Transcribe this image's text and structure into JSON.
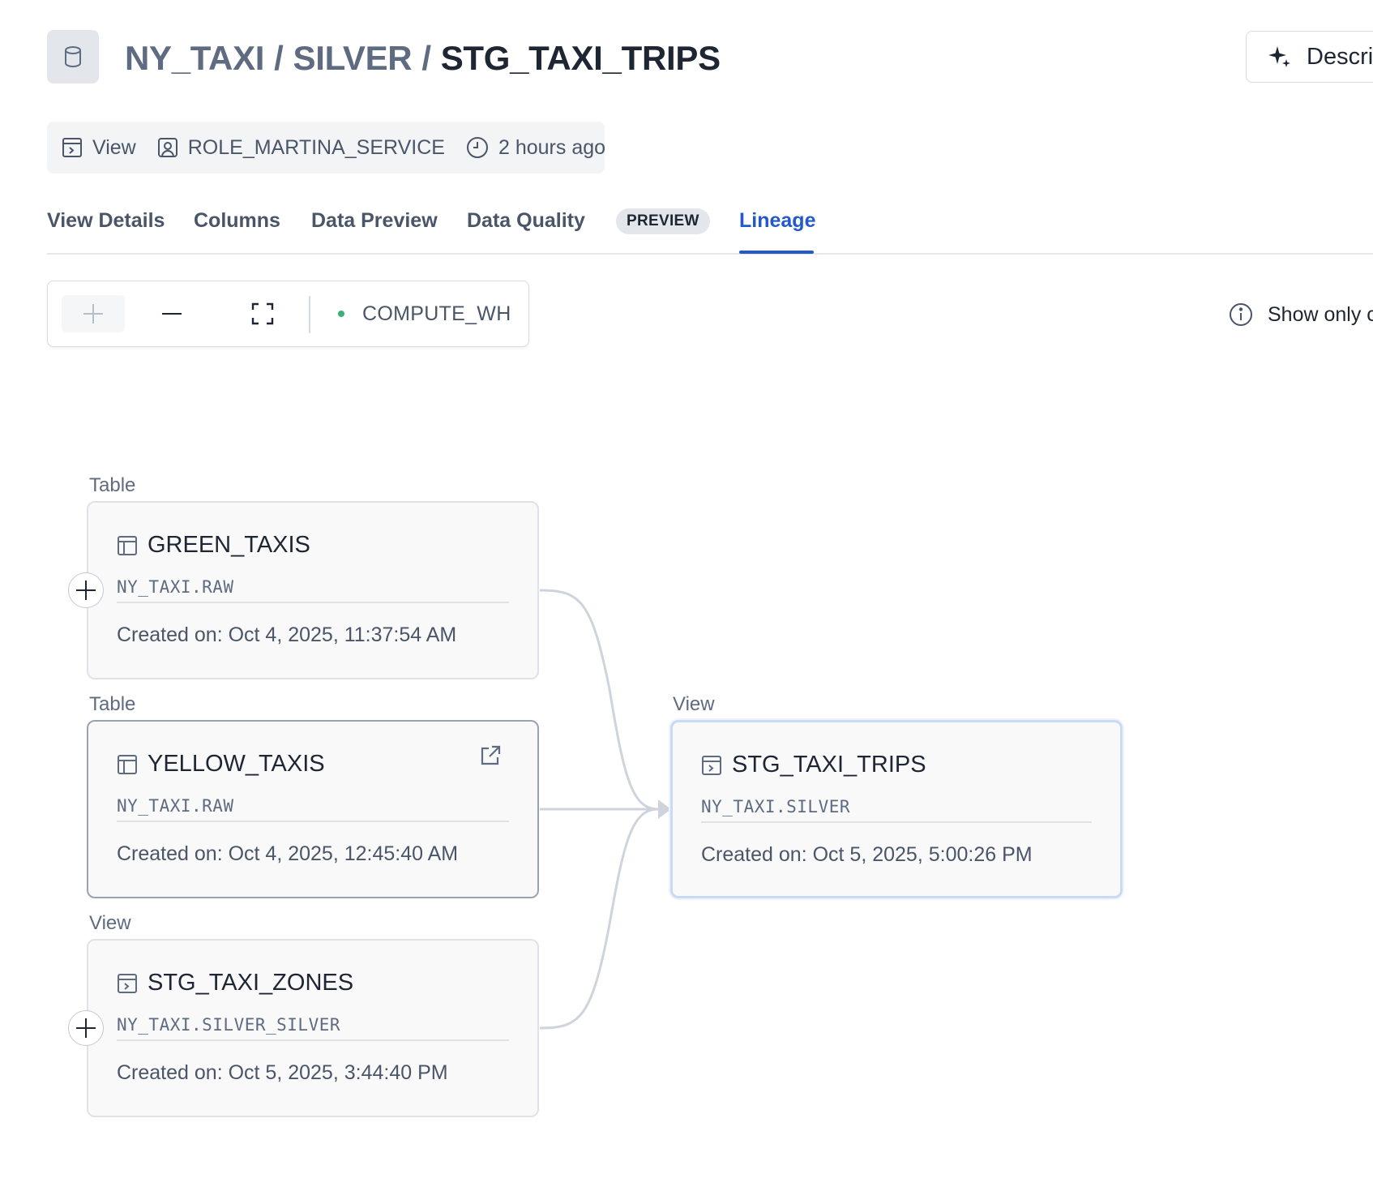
{
  "header": {
    "database": "NY_TAXI",
    "schema": "SILVER",
    "object_name": "STG_TAXI_TRIPS",
    "separator": "/",
    "describe_label": "Descri"
  },
  "meta": {
    "object_type": "View",
    "owner_role": "ROLE_MARTINA_SERVICE",
    "last_modified": "2 hours ago"
  },
  "tabs": [
    {
      "label": "View Details",
      "active": false
    },
    {
      "label": "Columns",
      "active": false
    },
    {
      "label": "Data Preview",
      "active": false
    },
    {
      "label": "Data Quality",
      "active": false,
      "badge": "PREVIEW"
    },
    {
      "label": "Lineage",
      "active": true
    }
  ],
  "toolbar": {
    "warehouse": "COMPUTE_WH",
    "warehouse_status_color": "#3bb07a",
    "show_only_label": "Show only c"
  },
  "lineage": {
    "upstream": [
      {
        "type": "Table",
        "name": "GREEN_TAXIS",
        "path": "NY_TAXI.RAW",
        "created": "Created on: Oct 4, 2025, 11:37:54 AM",
        "expandable": true
      },
      {
        "type": "Table",
        "name": "YELLOW_TAXIS",
        "path": "NY_TAXI.RAW",
        "created": "Created on: Oct 4, 2025, 12:45:40 AM",
        "expandable": false
      },
      {
        "type": "View",
        "name": "STG_TAXI_ZONES",
        "path": "NY_TAXI.SILVER_SILVER",
        "created": "Created on: Oct 5, 2025, 3:44:40 PM",
        "expandable": true
      }
    ],
    "selected": {
      "type": "View",
      "name": "STG_TAXI_TRIPS",
      "path": "NY_TAXI.SILVER",
      "created": "Created on: Oct 5, 2025, 5:00:26 PM"
    }
  },
  "colors": {
    "accent": "#2459c9",
    "edge": "#cfd4dc",
    "selected_border": "#c9daf5"
  }
}
